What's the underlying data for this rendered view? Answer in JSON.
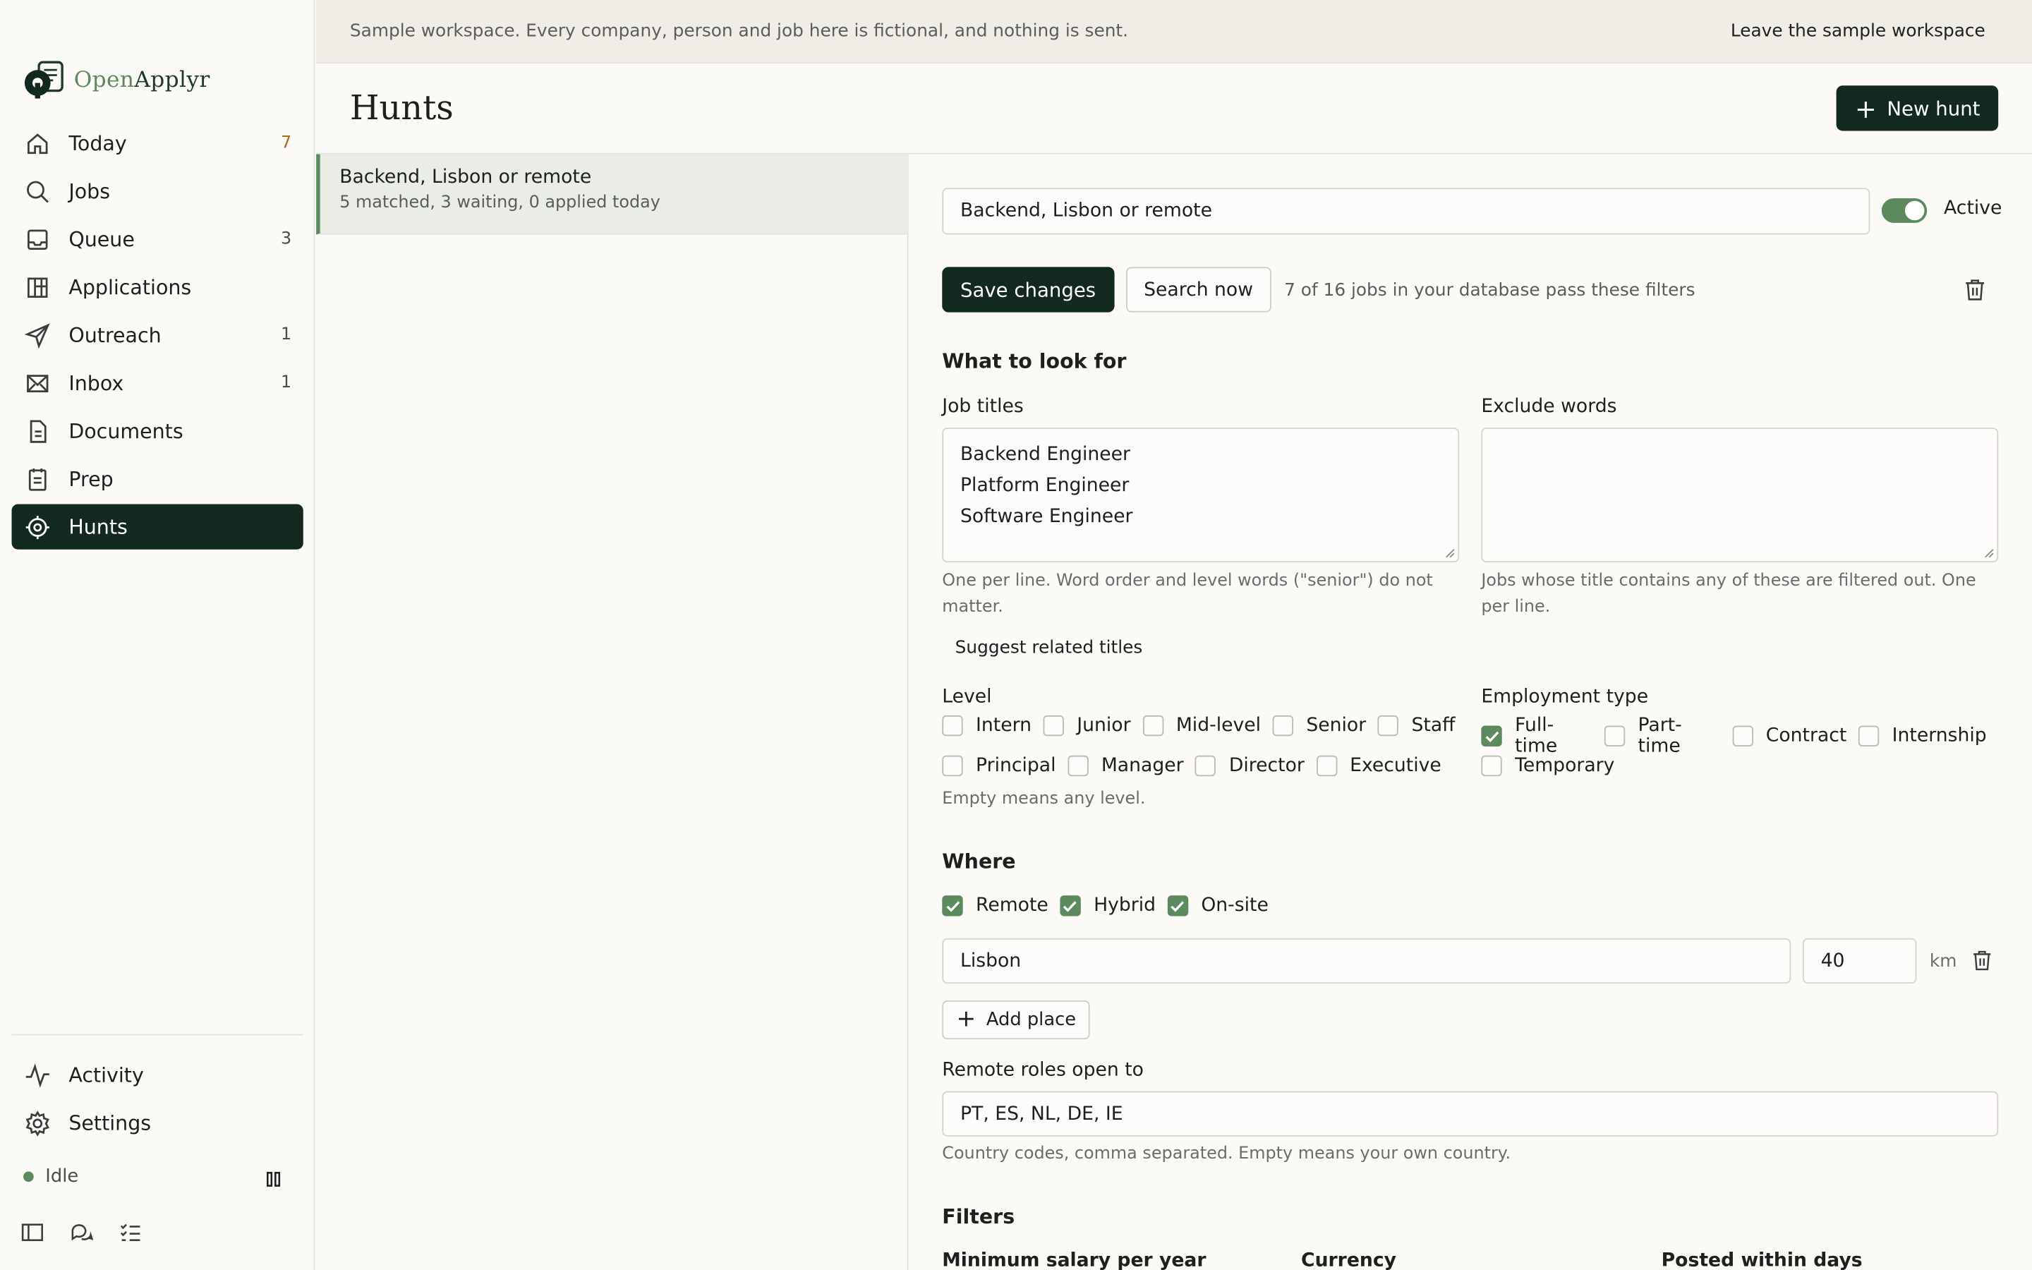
{
  "app": {
    "logo_part1": "Open",
    "logo_part2": "Applyr"
  },
  "nav": {
    "items": [
      {
        "label": "Today",
        "badge": "7",
        "icon": "home-icon"
      },
      {
        "label": "Jobs",
        "badge": "",
        "icon": "search-icon"
      },
      {
        "label": "Queue",
        "badge": "3",
        "icon": "inbox-tray-icon"
      },
      {
        "label": "Applications",
        "badge": "",
        "icon": "board-icon"
      },
      {
        "label": "Outreach",
        "badge": "1",
        "icon": "send-icon"
      },
      {
        "label": "Inbox",
        "badge": "1",
        "icon": "mail-icon"
      },
      {
        "label": "Documents",
        "badge": "",
        "icon": "document-icon"
      },
      {
        "label": "Prep",
        "badge": "",
        "icon": "clipboard-icon"
      },
      {
        "label": "Hunts",
        "badge": "",
        "icon": "target-icon",
        "active": true
      }
    ],
    "bottom": [
      {
        "label": "Activity",
        "icon": "activity-icon"
      },
      {
        "label": "Settings",
        "icon": "gear-icon"
      }
    ],
    "status": "Idle"
  },
  "banner": {
    "text": "Sample workspace. Every company, person and job here is fictional, and nothing is sent.",
    "link": "Leave the sample workspace"
  },
  "header": {
    "title": "Hunts",
    "new_button": "New hunt"
  },
  "hunts": [
    {
      "name": "Backend, Lisbon or remote",
      "summary": "5 matched, 3 waiting, 0 applied today"
    }
  ],
  "detail": {
    "name_value": "Backend, Lisbon or remote",
    "active_label": "Active",
    "save_label": "Save changes",
    "search_label": "Search now",
    "pass_text": "7 of 16 jobs in your database pass these filters",
    "look_for_title": "What to look for",
    "job_titles_label": "Job titles",
    "job_titles": [
      "Backend Engineer",
      "Platform Engineer",
      "Software Engineer"
    ],
    "job_titles_help": "One per line. Word order and level words (\"senior\") do not matter.",
    "exclude_label": "Exclude words",
    "exclude_help": "Jobs whose title contains any of these are filtered out. One per line.",
    "suggest_label": "Suggest related titles",
    "level_label": "Level",
    "levels_row1": [
      {
        "label": "Intern",
        "checked": false
      },
      {
        "label": "Junior",
        "checked": false
      },
      {
        "label": "Mid-level",
        "checked": false
      },
      {
        "label": "Senior",
        "checked": false
      },
      {
        "label": "Staff",
        "checked": false
      }
    ],
    "levels_row2": [
      {
        "label": "Principal",
        "checked": false
      },
      {
        "label": "Manager",
        "checked": false
      },
      {
        "label": "Director",
        "checked": false
      },
      {
        "label": "Executive",
        "checked": false
      }
    ],
    "level_help": "Empty means any level.",
    "employment_label": "Employment type",
    "employment_row1": [
      {
        "label": "Full-time",
        "checked": true
      },
      {
        "label": "Part-time",
        "checked": false
      },
      {
        "label": "Contract",
        "checked": false
      },
      {
        "label": "Internship",
        "checked": false
      }
    ],
    "employment_row2": [
      {
        "label": "Temporary",
        "checked": false
      }
    ],
    "where_title": "Where",
    "where": [
      {
        "label": "Remote",
        "checked": true
      },
      {
        "label": "Hybrid",
        "checked": true
      },
      {
        "label": "On-site",
        "checked": true
      }
    ],
    "place_value": "Lisbon",
    "radius_value": "40",
    "radius_unit": "km",
    "add_place_label": "Add place",
    "remote_label": "Remote roles open to",
    "remote_value": "PT, ES, NL, DE, IE",
    "remote_help": "Country codes, comma separated. Empty means your own country.",
    "filters_title": "Filters",
    "filters": {
      "salary_label": "Minimum salary per year",
      "currency_label": "Currency",
      "posted_label": "Posted within days"
    }
  },
  "colors": {
    "accent": "#13291f",
    "green": "#5c8a5e",
    "banner_bg": "#f0ede6"
  }
}
